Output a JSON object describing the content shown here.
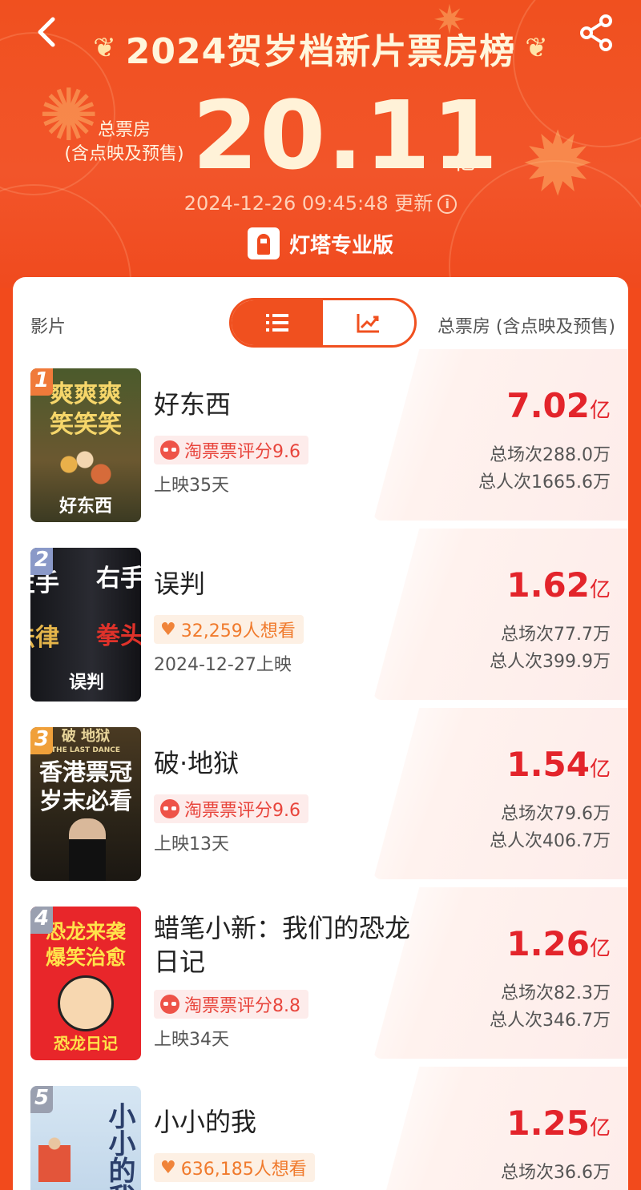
{
  "header": {
    "title": "2024贺岁档新片票房榜",
    "total_label_line1": "总票房",
    "total_label_line2": "(含点映及预售)",
    "total_value": "20.11",
    "total_unit": "亿",
    "updated_time": "2024-12-26 09:45:48 更新",
    "brand": "灯塔专业版"
  },
  "table_header": {
    "film_label": "影片",
    "total_label": "总票房 (含点映及预售)",
    "view_toggle": [
      "list",
      "chart"
    ],
    "active_view": "list"
  },
  "films": [
    {
      "rank": "1",
      "name": "好东西",
      "tag_type": "rating",
      "tag_text": "淘票票评分9.6",
      "release": "上映35天",
      "box": "7.02",
      "box_unit": "亿",
      "screenings": "总场次288.0万",
      "admissions": "总人次1665.6万",
      "poster": {
        "line1": "爽爽爽",
        "line2": "笑笑笑",
        "logo": "好东西",
        "bg": "#5d6b3a",
        "fg": "#f6d66a"
      }
    },
    {
      "rank": "2",
      "name": "误判",
      "tag_type": "want",
      "tag_text": "32,259人想看",
      "release": "2024-12-27上映",
      "box": "1.62",
      "box_unit": "亿",
      "screenings": "总场次77.7万",
      "admissions": "总人次399.9万",
      "poster": {
        "left_top": "左手",
        "left_bottom": "法律",
        "right_top": "右手",
        "right_bottom": "拳头",
        "logo": "误判",
        "bg": "#1d1d22",
        "fg": "#ffffff"
      }
    },
    {
      "rank": "3",
      "name": "破·地狱",
      "tag_type": "rating",
      "tag_text": "淘票票评分9.6",
      "release": "上映13天",
      "box": "1.54",
      "box_unit": "亿",
      "screenings": "总场次79.6万",
      "admissions": "总人次406.7万",
      "poster": {
        "top": "破 地狱",
        "sub": "THE LAST DANCE",
        "line1": "香港票冠",
        "line2": "岁末必看",
        "bg": "#3a3020",
        "fg": "#ffffff"
      }
    },
    {
      "rank": "4",
      "name": "蜡笔小新：我们的恐龙日记",
      "tag_type": "rating",
      "tag_text": "淘票票评分8.8",
      "release": "上映34天",
      "box": "1.26",
      "box_unit": "亿",
      "screenings": "总场次82.3万",
      "admissions": "总人次346.7万",
      "poster": {
        "line1": "恐龙来袭",
        "line2": "爆笑治愈",
        "logo": "恐龙日记",
        "bg": "#e8262a",
        "fg": "#ffe24a"
      }
    },
    {
      "rank": "5",
      "name": "小小的我",
      "tag_type": "want",
      "tag_text": "636,185人想看",
      "release": "",
      "box": "1.25",
      "box_unit": "亿",
      "screenings": "总场次36.6万",
      "admissions": "",
      "poster": {
        "title": "小小的我",
        "bg": "#cfe1f0",
        "fg": "#2b3f6b"
      }
    }
  ],
  "colors": {
    "header_bg": "#f0501f",
    "accent": "#f0501f",
    "box_red": "#e3242b"
  }
}
